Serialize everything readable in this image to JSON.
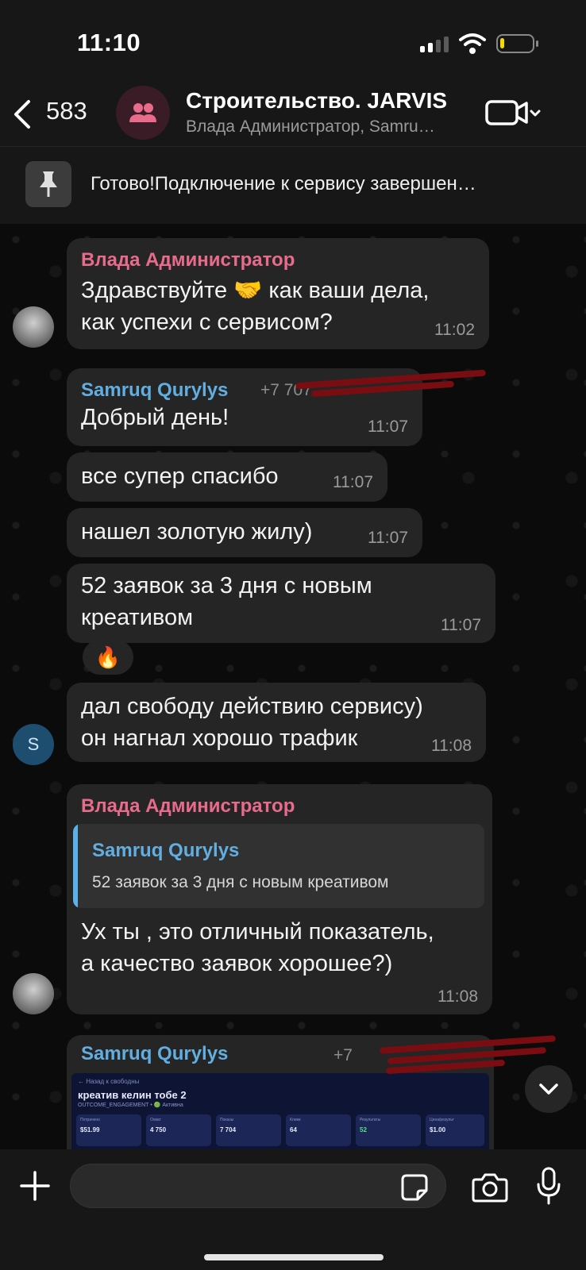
{
  "status_bar": {
    "time": "11:10",
    "battery_level": 0.12
  },
  "header": {
    "back_count": "583",
    "title": "Строительство. JARVIS",
    "subtitle": "Влада Администратор, Samru…"
  },
  "pinned": {
    "text": "Готово!Подключение к сервису завершен…"
  },
  "messages": [
    {
      "sender": "Влада Администратор",
      "lines": [
        "Здравствуйте 🤝 как ваши дела,",
        "как успехи с сервисом?"
      ],
      "time": "11:02"
    },
    {
      "sender": "Samruq Qurylys",
      "phone": "+7 707",
      "lines": [
        "Добрый день!"
      ],
      "time": "11:07"
    },
    {
      "lines": [
        "все супер спасибо"
      ],
      "time": "11:07"
    },
    {
      "lines": [
        "нашел золотую жилу)"
      ],
      "time": "11:07"
    },
    {
      "lines": [
        "52 заявок за 3 дня с новым",
        "креативом"
      ],
      "time": "11:07",
      "reaction": "🔥"
    },
    {
      "lines": [
        "дал свободу действию сервису)",
        "он нагнал хорошо трафик"
      ],
      "time": "11:08",
      "avatar_letter": "S"
    },
    {
      "sender": "Влада Администратор",
      "reply": {
        "sender": "Samruq Qurylys",
        "text": "52 заявок за 3 дня с новым креативом"
      },
      "lines": [
        "Ух ты , это отличный показатель,",
        "а качество заявок хорошее?)"
      ],
      "time": "11:08"
    },
    {
      "sender": "Samruq Qurylys",
      "phone": "+7",
      "image": {
        "back": "← Назад к свободны",
        "title": "креатив келин тобе 2",
        "subtitle": "OUTCOME_ENGAGEMENT • 🟢 Активна",
        "cards": [
          {
            "label": "Потрачено",
            "value": "$51.99"
          },
          {
            "label": "Охват",
            "value": "4 750"
          },
          {
            "label": "Показы",
            "value": "7 704"
          },
          {
            "label": "Клики",
            "value": "64"
          },
          {
            "label": "Результаты",
            "value": "52"
          },
          {
            "label": "Цена/результ",
            "value": "$1.00"
          }
        ]
      }
    }
  ],
  "icons": {
    "back": "chevron-left-icon",
    "group": "group-people-icon",
    "video": "video-camera-icon",
    "pin": "pin-icon",
    "scroll": "chevron-down-icon",
    "plus": "plus-icon",
    "sticker": "sticker-icon",
    "camera": "camera-icon",
    "mic": "microphone-icon"
  },
  "colors": {
    "sender_pink": "#e96b8c",
    "sender_blue": "#62aee0",
    "bubble": "#252525",
    "background": "#0b0b0b"
  }
}
